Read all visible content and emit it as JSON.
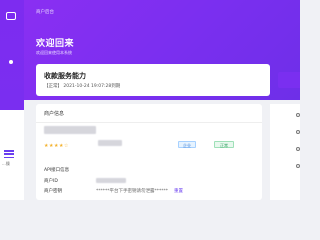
{
  "sidebar": {
    "bottom_label": "...操"
  },
  "header": {
    "breadcrumb": "商户后台"
  },
  "welcome": {
    "title": "欢迎回来",
    "subtitle": "欢迎回来使用本系统"
  },
  "capability": {
    "title": "收款服务能力",
    "subtitle": "【正常】 2021-10-24 19:07:28到期"
  },
  "merchant": {
    "section_title": "商户信息",
    "stars": "★★★★☆",
    "tag_type": "企业",
    "tag_status": "正常",
    "api_label": "API接口信息",
    "id_label": "商户ID",
    "key_label": "商户密钥",
    "key_value": "******平台下手密钥请勿泄露******",
    "reset_link": "重置"
  },
  "colors": {
    "brand": "#7b2ff0",
    "star": "#f3b12b"
  }
}
